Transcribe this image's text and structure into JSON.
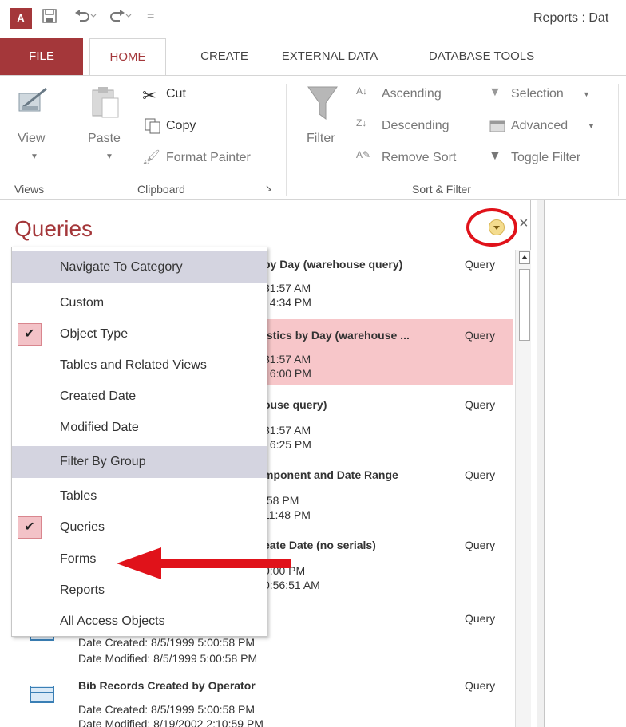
{
  "window": {
    "title": "Reports : Dat"
  },
  "quick_access": {
    "logo": "A",
    "save_icon": "save-icon",
    "undo_icon": "undo-icon",
    "redo_icon": "redo-icon",
    "customize": "="
  },
  "tabs": [
    "FILE",
    "HOME",
    "CREATE",
    "EXTERNAL DATA",
    "DATABASE TOOLS"
  ],
  "ribbon": {
    "view": "View",
    "paste": "Paste",
    "cut": "Cut",
    "copy": "Copy",
    "format_painter": "Format Painter",
    "filter": "Filter",
    "ascending": "Ascending",
    "descending": "Descending",
    "remove_sort": "Remove Sort",
    "selection": "Selection",
    "advanced": "Advanced",
    "toggle_filter": "Toggle Filter",
    "groups": {
      "views": "Views",
      "clipboard": "Clipboard",
      "sort_filter": "Sort & Filter"
    }
  },
  "nav": {
    "title": "Queries",
    "items": [
      {
        "name": "by Day (warehouse query)",
        "type": "Query",
        "created": "31:57 AM",
        "modified": "14:34 PM"
      },
      {
        "name": "istics by Day (warehouse ...",
        "type": "Query",
        "created": "31:57 AM",
        "modified": "16:00 PM"
      },
      {
        "name": "ouse query)",
        "type": "Query",
        "created": "31:57 AM",
        "modified": "16:25 PM"
      },
      {
        "name": "mponent and Date Range",
        "type": "Query",
        "created": ":58 PM",
        "modified": "11:48 PM"
      },
      {
        "name": "eate Date (no serials)",
        "type": "Query",
        "created": "0:00 PM",
        "modified": "0:56:51 AM"
      },
      {
        "name": "",
        "type": "Query",
        "created": "Date Created: 8/5/1999 5:00:58 PM",
        "modified": "Date Modified: 8/5/1999 5:00:58 PM"
      },
      {
        "name": "Bib Records Created by Operator",
        "type": "Query",
        "created": "Date Created: 8/5/1999 5:00:58 PM",
        "modified": "Date Modified: 8/19/2002 2:10:59 PM"
      }
    ]
  },
  "menu": {
    "navigate_header": "Navigate To Category",
    "navigate_items": [
      "Custom",
      "Object Type",
      "Tables and Related Views",
      "Created Date",
      "Modified Date"
    ],
    "filter_header": "Filter By Group",
    "filter_items": [
      "Tables",
      "Queries",
      "Forms",
      "Reports",
      "All Access Objects"
    ],
    "checked": [
      "Object Type",
      "Queries"
    ]
  },
  "colors": {
    "accent": "#a4373a",
    "selection": "#f7c6c9",
    "annotation": "#e0121a",
    "menu_header": "#d4d4e0"
  }
}
